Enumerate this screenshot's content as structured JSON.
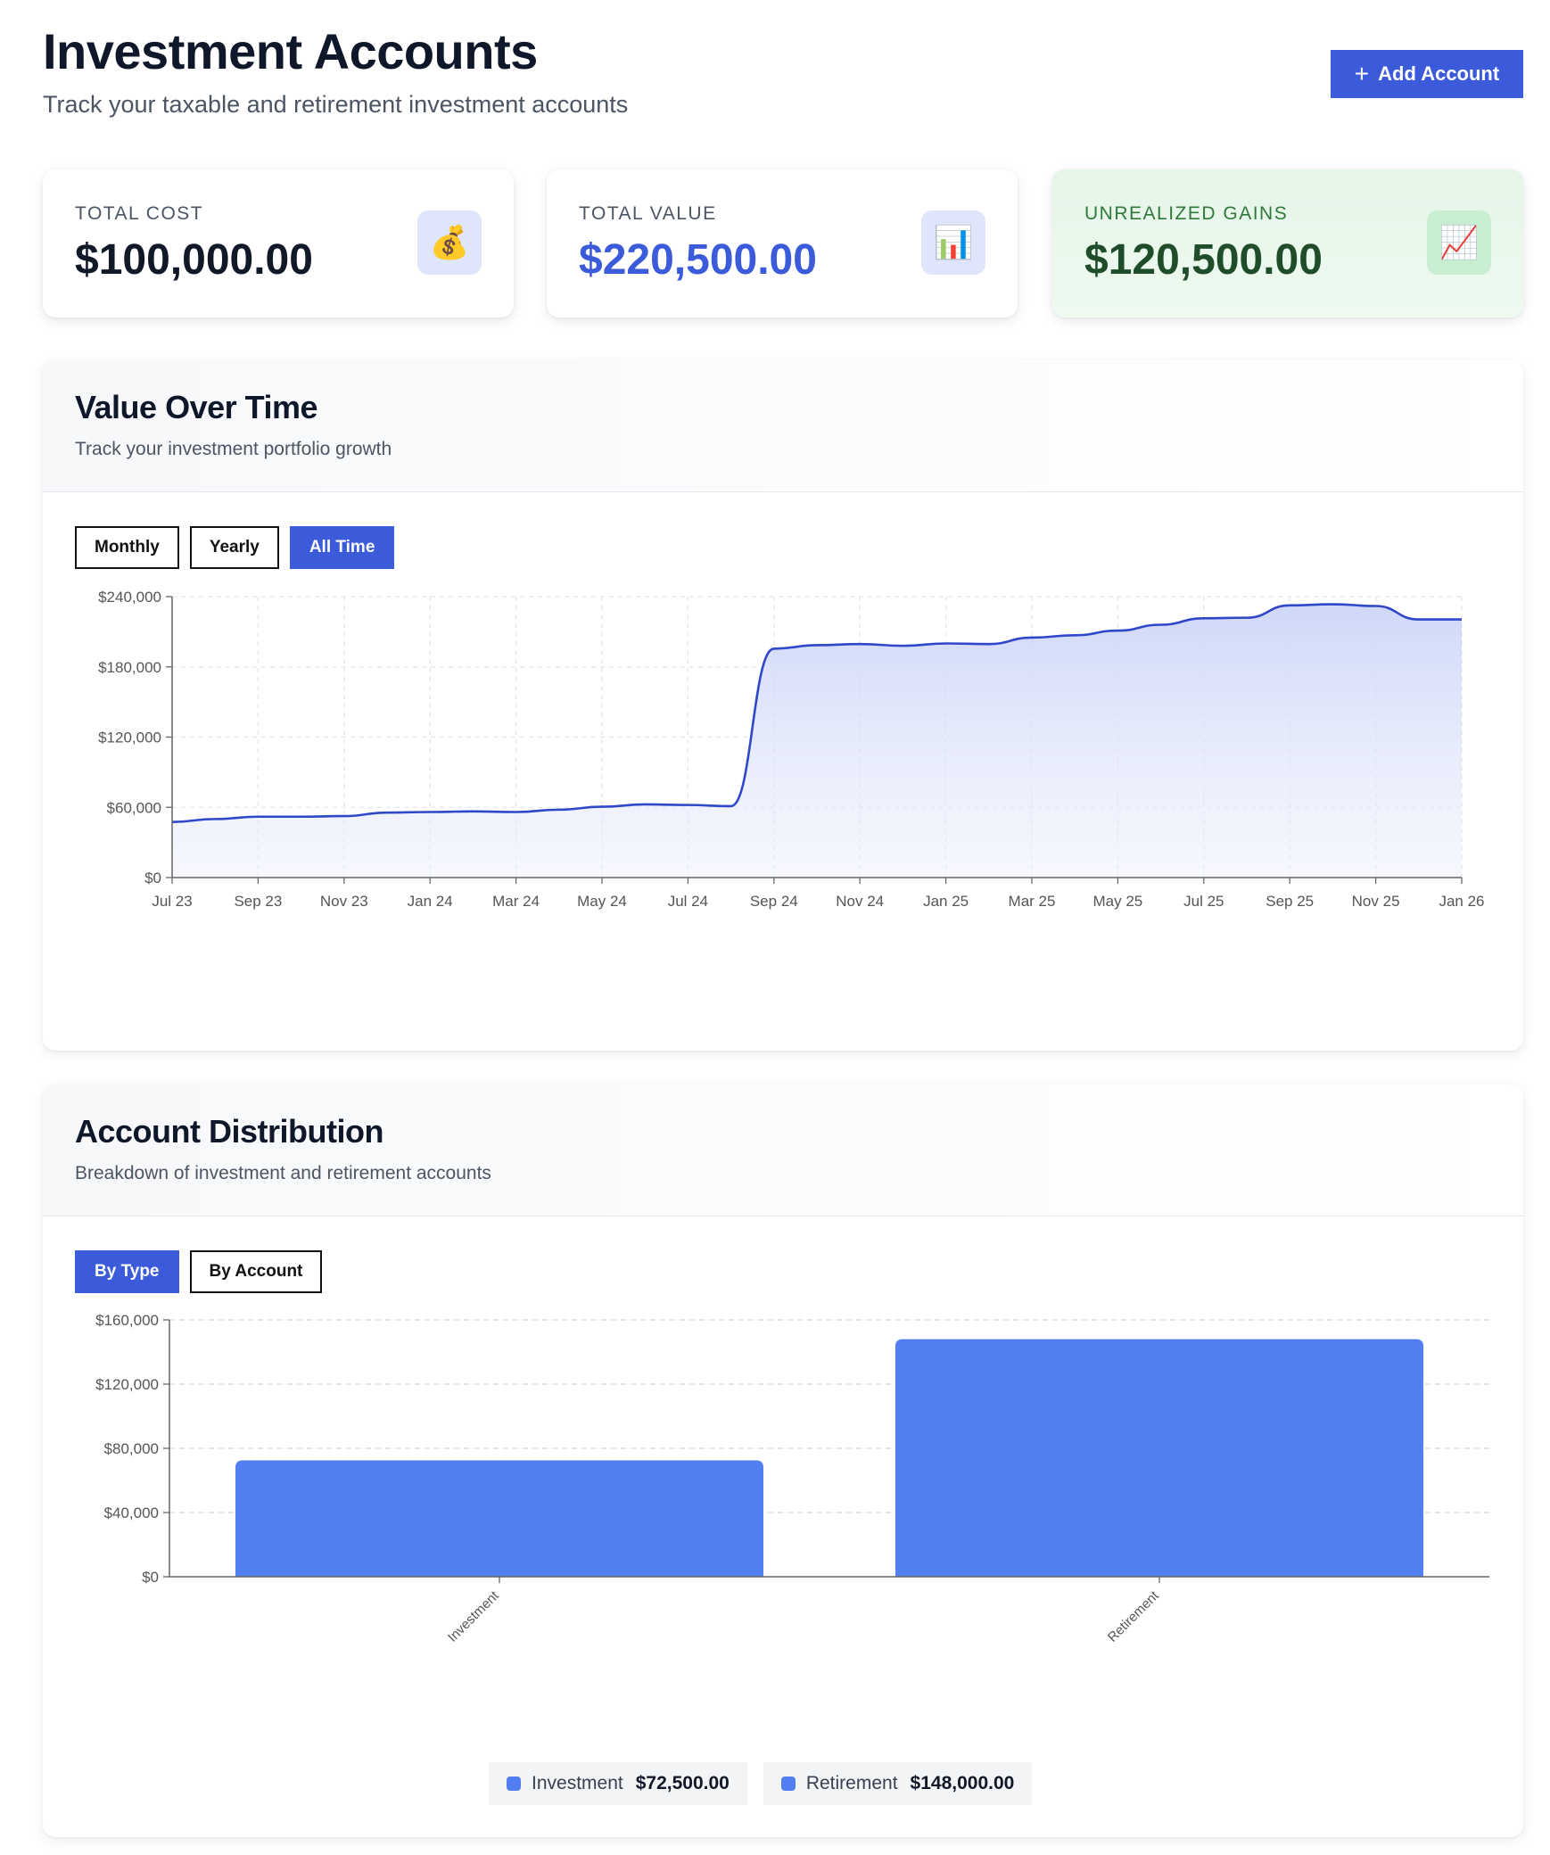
{
  "header": {
    "title": "Investment Accounts",
    "subtitle": "Track your taxable and retirement investment accounts",
    "add_button_label": "Add Account"
  },
  "stats": [
    {
      "label": "TOTAL COST",
      "value": "$100,000.00",
      "icon": "money-bag-icon",
      "glyph": "💰"
    },
    {
      "label": "TOTAL VALUE",
      "value": "$220,500.00",
      "icon": "bar-chart-icon",
      "glyph": "📊"
    },
    {
      "label": "UNREALIZED GAINS",
      "value": "$120,500.00",
      "icon": "chart-increasing-icon",
      "glyph": "📈"
    }
  ],
  "value_panel": {
    "title": "Value Over Time",
    "subtitle": "Track your investment portfolio growth",
    "tabs": [
      "Monthly",
      "Yearly",
      "All Time"
    ],
    "active_tab": "All Time"
  },
  "distribution_panel": {
    "title": "Account Distribution",
    "subtitle": "Breakdown of investment and retirement accounts",
    "tabs": [
      "By Type",
      "By Account"
    ],
    "active_tab": "By Type",
    "legend": [
      {
        "name": "Investment",
        "value": "$72,500.00"
      },
      {
        "name": "Retirement",
        "value": "$148,000.00"
      }
    ]
  },
  "colors": {
    "accent": "#3b5bdb",
    "line": "#2f47c9",
    "bar": "#527ff0",
    "gain_text": "#1f4d2a"
  },
  "chart_data": [
    {
      "type": "area",
      "title": "",
      "xlabel": "",
      "ylabel": "",
      "ylim": [
        0,
        240000
      ],
      "yticks": [
        "$0",
        "$60,000",
        "$120,000",
        "$180,000",
        "$240,000"
      ],
      "xticks": [
        "Jul 23",
        "Sep 23",
        "Nov 23",
        "Jan 24",
        "Mar 24",
        "May 24",
        "Jul 24",
        "Sep 24",
        "Nov 24",
        "Jan 25",
        "Mar 25",
        "May 25",
        "Jul 25",
        "Sep 25",
        "Nov 25",
        "Jan 26"
      ],
      "grid": true,
      "x": [
        "Jul 23",
        "Aug 23",
        "Sep 23",
        "Oct 23",
        "Nov 23",
        "Dec 23",
        "Jan 24",
        "Feb 24",
        "Mar 24",
        "Apr 24",
        "May 24",
        "Jun 24",
        "Jul 24",
        "Aug 24",
        "Sep 24",
        "Oct 24",
        "Nov 24",
        "Dec 24",
        "Jan 25",
        "Feb 25",
        "Mar 25",
        "Apr 25",
        "May 25",
        "Jun 25",
        "Jul 25",
        "Aug 25",
        "Sep 25",
        "Oct 25",
        "Nov 25",
        "Dec 25",
        "Jan 26"
      ],
      "values": [
        47500,
        50000,
        52000,
        52000,
        52500,
        55500,
        56000,
        56500,
        56000,
        58000,
        60500,
        62500,
        62000,
        61000,
        195500,
        198500,
        199500,
        198000,
        200000,
        199500,
        205000,
        207000,
        211000,
        216000,
        221500,
        222000,
        232500,
        233500,
        232000,
        220500,
        220500
      ]
    },
    {
      "type": "bar",
      "title": "",
      "xlabel": "",
      "ylabel": "",
      "categories": [
        "Investment",
        "Retirement"
      ],
      "values": [
        72500,
        148000
      ],
      "ylim": [
        0,
        160000
      ],
      "yticks": [
        "$0",
        "$40,000",
        "$80,000",
        "$120,000",
        "$160,000"
      ],
      "grid": true,
      "legend": "bottom-center"
    }
  ]
}
